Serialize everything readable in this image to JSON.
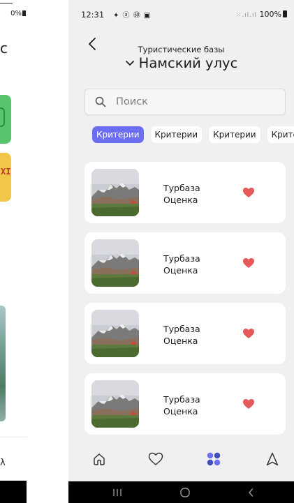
{
  "left_screen": {
    "status_text": "0%",
    "partial_letter": "с",
    "tile_glyph": "XI",
    "bottom_glyph": "λ"
  },
  "status_bar": {
    "time": "12:31",
    "notification_icons": "✦ ⓐ ㊿ ▣",
    "signal_glyphs": "⁙.ıl.ıl",
    "battery_percent": "100%"
  },
  "header": {
    "subtitle": "Туристические базы",
    "title": "Намский улус"
  },
  "search": {
    "placeholder": "Поиск"
  },
  "chips": [
    {
      "label": "Критерии",
      "active": true
    },
    {
      "label": "Критерии",
      "active": false
    },
    {
      "label": "Критерии",
      "active": false
    },
    {
      "label": "Крите",
      "active": false
    }
  ],
  "cards": [
    {
      "name": "Турбаза",
      "rating_label": "Оценка"
    },
    {
      "name": "Турбаза",
      "rating_label": "Оценка"
    },
    {
      "name": "Турбаза",
      "rating_label": "Оценка"
    },
    {
      "name": "Турбаза",
      "rating_label": "Оценка"
    }
  ],
  "colors": {
    "accent": "#6b6ef2",
    "heart": "#e45a5a",
    "background": "#f0f0f3",
    "card": "#ffffff"
  },
  "icons": {
    "back": "chevron-left-icon",
    "title_dropdown": "chevron-down-icon",
    "search": "search-icon",
    "favorite": "heart-icon",
    "tabs": [
      "home-icon",
      "heart-outline-icon",
      "grid-dots-icon",
      "navigation-arrow-icon"
    ],
    "system_nav": [
      "recent-apps-icon",
      "home-circle-icon",
      "back-chevron-icon"
    ]
  }
}
